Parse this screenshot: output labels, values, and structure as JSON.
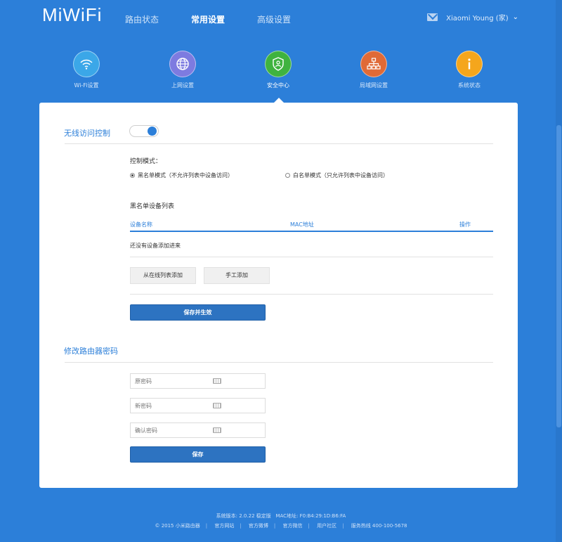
{
  "header": {
    "logo": "MiWiFi",
    "nav": [
      {
        "label": "路由状态"
      },
      {
        "label": "常用设置",
        "active": true
      },
      {
        "label": "高级设置"
      }
    ],
    "user_name": "Xiaomi Young (家)"
  },
  "icon_nav": [
    {
      "label": "Wi-Fi设置",
      "color": "#3ba7e8",
      "icon": "wifi-icon"
    },
    {
      "label": "上网设置",
      "color": "#7d7be0",
      "icon": "globe-icon"
    },
    {
      "label": "安全中心",
      "color": "#3fb33f",
      "icon": "shield-icon",
      "active": true
    },
    {
      "label": "局域网设置",
      "color": "#e06a36",
      "icon": "network-icon"
    },
    {
      "label": "系统状态",
      "color": "#f5a61c",
      "icon": "info-icon"
    }
  ],
  "wireless_access": {
    "title": "无线访问控制",
    "toggle_on": true,
    "mode_label": "控制模式：",
    "blacklist_label": "黑名单模式（不允许列表中设备访问）",
    "whitelist_label": "白名单模式（只允许列表中设备访问）",
    "list_title": "黑名单设备列表",
    "columns": [
      "设备名称",
      "MAC地址",
      "操作"
    ],
    "empty_text": "还没有设备添加进来",
    "add_online_label": "从在线列表添加",
    "add_manual_label": "手工添加",
    "save_label": "保存并生效"
  },
  "password": {
    "title": "修改路由器密码",
    "old_placeholder": "原密码",
    "new_placeholder": "新密码",
    "confirm_placeholder": "确认密码",
    "save_label": "保存"
  },
  "footer": {
    "version": "系统版本: 2.0.22 稳定版",
    "mac": "MAC地址: F0:B4:29:1D:B6:FA",
    "copyright": "© 2015 小米路由器",
    "links": [
      "官方网站",
      "官方微博",
      "官方微信",
      "用户社区"
    ],
    "hotline": "服务热线 400-100-5678"
  }
}
